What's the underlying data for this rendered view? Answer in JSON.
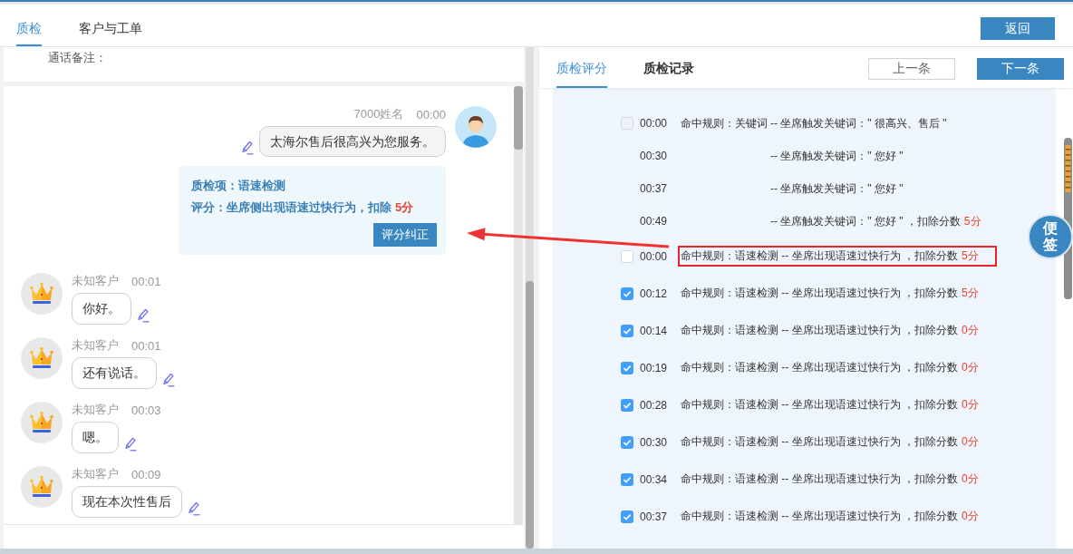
{
  "header": {
    "tabs": [
      {
        "label": "质检",
        "selected": true
      },
      {
        "label": "客户与工单",
        "selected": false
      }
    ],
    "back_button": "返回"
  },
  "call_note": {
    "label": "通话备注："
  },
  "chat": {
    "messages": [
      {
        "kind": "agent",
        "sender": "7000姓名",
        "time": "00:00",
        "text": "太海尔售后很高兴为您服务。"
      },
      {
        "kind": "qc_card",
        "item": "质检项：语速检测",
        "score_text": "评分：坐席侧出现语速过快行为，扣除",
        "score": "5分",
        "button": "评分纠正"
      },
      {
        "kind": "customer",
        "sender": "未知客户",
        "time": "00:01",
        "text": "你好。"
      },
      {
        "kind": "customer",
        "sender": "未知客户",
        "time": "00:01",
        "text": "还有说话。"
      },
      {
        "kind": "customer",
        "sender": "未知客户",
        "time": "00:03",
        "text": "嗯。"
      },
      {
        "kind": "customer",
        "sender": "未知客户",
        "time": "00:09",
        "text": "现在本次性售后"
      }
    ]
  },
  "qc_panel": {
    "tabs": [
      {
        "label": "质检评分",
        "selected": true
      },
      {
        "label": "质检记录",
        "selected": false
      }
    ],
    "prev_button": "上一条",
    "next_button": "下一条",
    "rows": [
      {
        "kind": "keyword",
        "checkbox": {
          "checked": false,
          "disabled": true
        },
        "time": "00:00",
        "rule": "命中规则：关键词",
        "detail": "-- 坐席触发关键词：\" 很高兴、售后 \"",
        "highlighted": false
      },
      {
        "kind": "keyword",
        "time": "00:30",
        "detail": "-- 坐席触发关键词：\" 您好 \"",
        "highlighted": false
      },
      {
        "kind": "keyword",
        "time": "00:37",
        "detail": "-- 坐席触发关键词：\" 您好 \"",
        "highlighted": false
      },
      {
        "kind": "keyword",
        "time": "00:49",
        "detail": "-- 坐席触发关键词：\" 您好 \" ，扣除分数",
        "score": "5分",
        "highlighted": false
      },
      {
        "kind": "speed",
        "checkbox": {
          "checked": false,
          "disabled": false
        },
        "time": "00:00",
        "text": "命中规则：语速检测 -- 坐席出现语速过快行为 ，扣除分数",
        "score": "5分",
        "highlighted": true
      },
      {
        "kind": "speed",
        "checkbox": {
          "checked": true,
          "disabled": false
        },
        "time": "00:12",
        "text": "命中规则：语速检测 -- 坐席出现语速过快行为 ，扣除分数",
        "score": "5分",
        "highlighted": false
      },
      {
        "kind": "speed",
        "checkbox": {
          "checked": true,
          "disabled": false
        },
        "time": "00:14",
        "text": "命中规则：语速检测 -- 坐席出现语速过快行为 ，扣除分数",
        "score": "0分",
        "highlighted": false
      },
      {
        "kind": "speed",
        "checkbox": {
          "checked": true,
          "disabled": false
        },
        "time": "00:19",
        "text": "命中规则：语速检测 -- 坐席出现语速过快行为 ，扣除分数",
        "score": "0分",
        "highlighted": false
      },
      {
        "kind": "speed",
        "checkbox": {
          "checked": true,
          "disabled": false
        },
        "time": "00:28",
        "text": "命中规则：语速检测 -- 坐席出现语速过快行为 ，扣除分数",
        "score": "0分",
        "highlighted": false
      },
      {
        "kind": "speed",
        "checkbox": {
          "checked": true,
          "disabled": false
        },
        "time": "00:30",
        "text": "命中规则：语速检测 -- 坐席出现语速过快行为 ，扣除分数",
        "score": "0分",
        "highlighted": false
      },
      {
        "kind": "speed",
        "checkbox": {
          "checked": true,
          "disabled": false
        },
        "time": "00:34",
        "text": "命中规则：语速检测 -- 坐席出现语速过快行为 ，扣除分数",
        "score": "0分",
        "highlighted": false
      },
      {
        "kind": "speed",
        "checkbox": {
          "checked": true,
          "disabled": false
        },
        "time": "00:37",
        "text": "命中规则：语速检测 -- 坐席出现语速过快行为 ，扣除分数",
        "score": "0分",
        "highlighted": false
      }
    ]
  },
  "note_button": "便签"
}
